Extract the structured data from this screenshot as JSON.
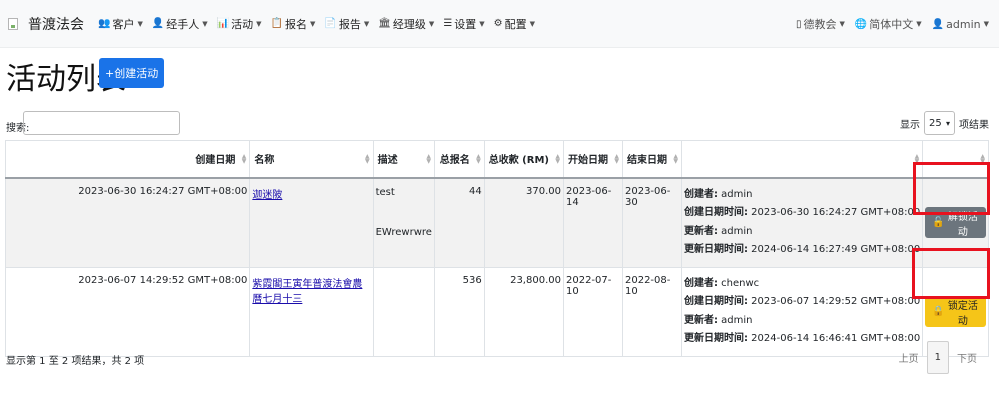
{
  "brand": {
    "name": "普渡法会"
  },
  "nav": {
    "left": [
      {
        "icon": "👥",
        "label": "客户"
      },
      {
        "icon": "👤",
        "label": "经手人"
      },
      {
        "icon": "📊",
        "label": "活动"
      },
      {
        "icon": "📋",
        "label": "报名"
      },
      {
        "icon": "📄",
        "label": "报告"
      },
      {
        "icon": "🏛",
        "label": "经理级"
      },
      {
        "icon": "☰",
        "label": "设置"
      },
      {
        "icon": "⚙",
        "label": "配置"
      }
    ],
    "right": [
      {
        "icon": "▯",
        "label": "德教会"
      },
      {
        "icon": "🌐",
        "label": "简体中文"
      },
      {
        "icon": "👤",
        "label": "admin"
      }
    ]
  },
  "page": {
    "title": "活动列表",
    "create_label": "+创建活动"
  },
  "search": {
    "label": "搜索:",
    "value": ""
  },
  "length": {
    "prefix": "显示",
    "value": "25",
    "suffix": "项结果"
  },
  "columns": [
    "创建日期",
    "名称",
    "描述",
    "总报名",
    "总收款 (RM)",
    "开始日期",
    "结束日期",
    "",
    ""
  ],
  "rows": [
    {
      "created": "2023-06-30 16:24:27 GMT+08:00",
      "name": "迦迷陂",
      "desc_lines": [
        "test",
        "EWrewrwre"
      ],
      "total_reg": "44",
      "total_amount": "370.00",
      "start": "2023-06-14",
      "end": "2023-06-30",
      "meta": [
        {
          "k": "创建者:",
          "v": "admin"
        },
        {
          "k": "创建日期时间:",
          "v": "2023-06-30 16:24:27 GMT+08:00"
        },
        {
          "k": "更新者:",
          "v": "admin"
        },
        {
          "k": "更新日期时间:",
          "v": "2024-06-14 16:27:49 GMT+08:00"
        }
      ],
      "action": "解锁活动"
    },
    {
      "created": "2023-06-07 14:29:52 GMT+08:00",
      "name": "紫霞閣王寅年普渡法會農曆七月十三",
      "desc_lines": [],
      "total_reg": "536",
      "total_amount": "23,800.00",
      "start": "2022-07-10",
      "end": "2022-08-10",
      "meta": [
        {
          "k": "创建者:",
          "v": "chenwc"
        },
        {
          "k": "创建日期时间:",
          "v": "2023-06-07 14:29:52 GMT+08:00"
        },
        {
          "k": "更新者:",
          "v": "admin"
        },
        {
          "k": "更新日期时间:",
          "v": "2024-06-14 16:46:41 GMT+08:00"
        }
      ],
      "action": "锁定活动"
    }
  ],
  "info": "显示第 1 至 2 项结果，共 2 项",
  "pager": {
    "prev": "上页",
    "current": "1",
    "next": "下页"
  },
  "colors": {
    "primary": "#1a73e8",
    "unlock": "#6c757d",
    "lock": "#f5c518",
    "highlight": "#e8121f"
  }
}
